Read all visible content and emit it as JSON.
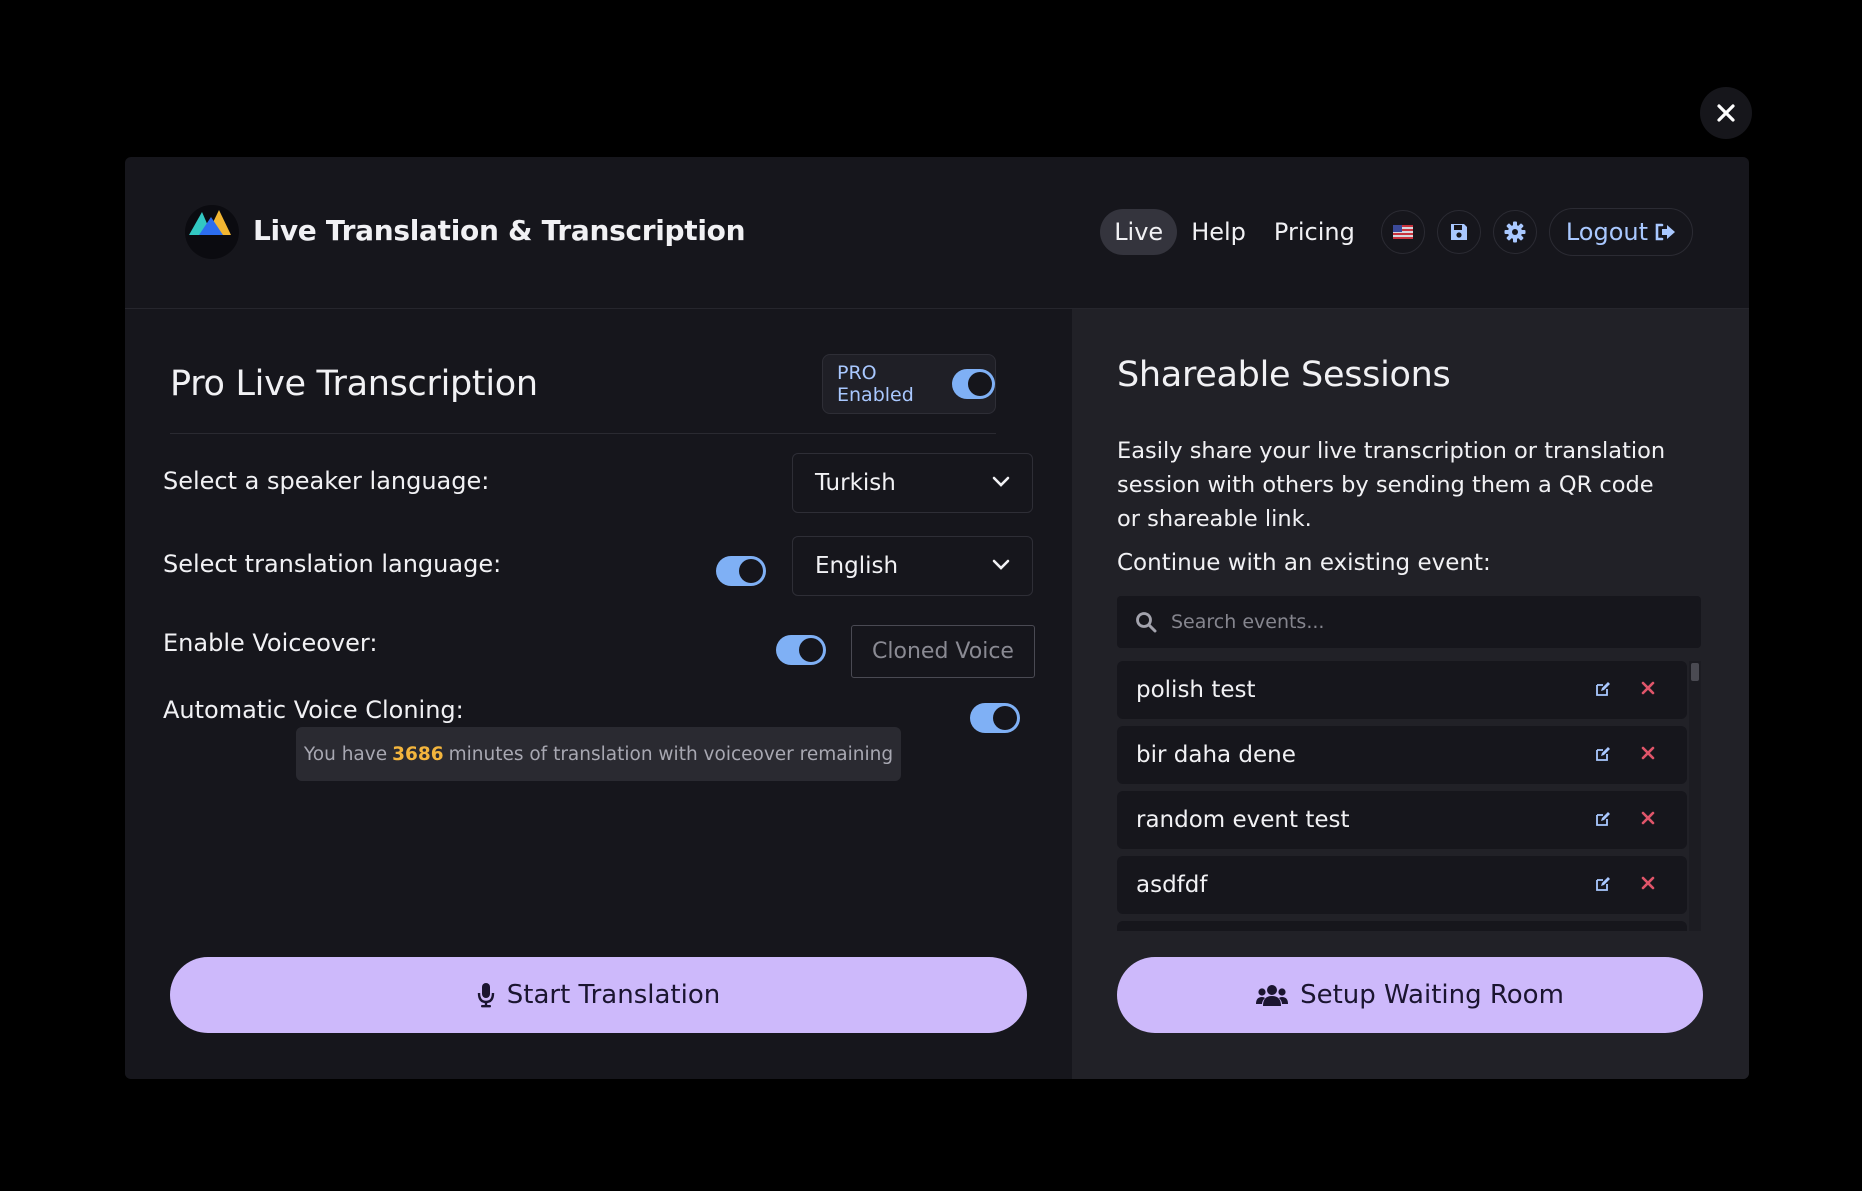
{
  "header": {
    "app_title": "Live Translation & Transcription",
    "nav": {
      "live": "Live",
      "help": "Help",
      "pricing": "Pricing",
      "logout": "Logout"
    },
    "icons": [
      "us-flag-icon",
      "save-icon",
      "gear-icon",
      "logout-icon"
    ]
  },
  "left": {
    "title": "Pro Live Transcription",
    "pro_badge": {
      "label": "PRO Enabled",
      "enabled": true
    },
    "speaker_label": "Select a speaker language:",
    "speaker_value": "Turkish",
    "translation_label": "Select translation language:",
    "translation_enabled": true,
    "translation_value": "English",
    "voiceover_label": "Enable Voiceover:",
    "voiceover_enabled": true,
    "cloned_voice_placeholder": "Cloned Voice",
    "auto_clone_label": "Automatic Voice Cloning:",
    "auto_clone_enabled": true,
    "minutes": {
      "prefix": "You have",
      "count": "3686",
      "suffix": "minutes of translation with voiceover remaining"
    },
    "start_button": "Start Translation"
  },
  "right": {
    "title": "Shareable Sessions",
    "description": "Easily share your live transcription or translation session with others by sending them a QR code or shareable link.",
    "continue_label": "Continue with an existing event:",
    "search_placeholder": "Search events...",
    "events": [
      {
        "name": "polish test"
      },
      {
        "name": "bir daha dene"
      },
      {
        "name": "random event test"
      },
      {
        "name": "asdfdf"
      }
    ],
    "waiting_room_button": "Setup Waiting Room"
  },
  "colors": {
    "accent": "#cdb9fb",
    "toggle": "#7fb0f5",
    "highlight": "#f3b53d",
    "delete": "#e0556a"
  }
}
